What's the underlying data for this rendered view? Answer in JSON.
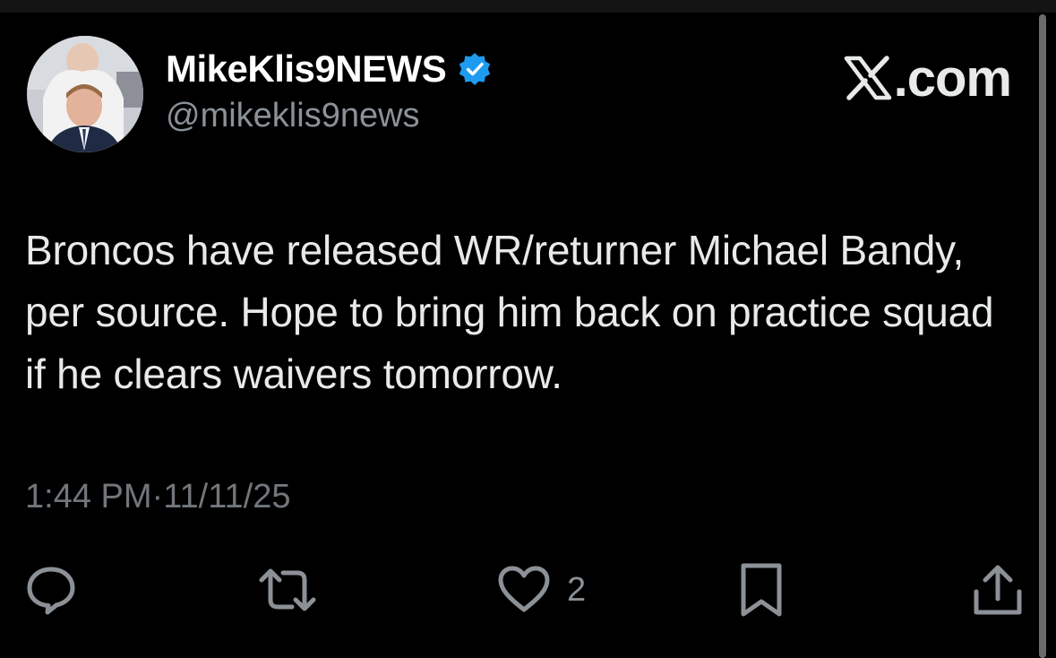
{
  "author": {
    "display_name": "MikeKlis9NEWS",
    "handle": "@mikeklis9news",
    "verified": true,
    "avatar_icon": "person-avatar"
  },
  "brand": {
    "icon": "x-logo-icon",
    "suffix": ".com"
  },
  "tweet": {
    "text": "Broncos have released WR/returner Michael Bandy, per source. Hope to bring him back on practice squad if he clears waivers tomorrow.",
    "time": "1:44 PM",
    "separator": "·",
    "date": "11/11/25"
  },
  "actions": {
    "reply_icon": "reply-icon",
    "retweet_icon": "retweet-icon",
    "like_icon": "heart-icon",
    "like_count": "2",
    "bookmark_icon": "bookmark-icon",
    "share_icon": "share-icon"
  },
  "colors": {
    "background": "#000000",
    "text": "#e7e9ea",
    "secondary_text": "#71767b",
    "verified_blue": "#1d9bf0"
  }
}
